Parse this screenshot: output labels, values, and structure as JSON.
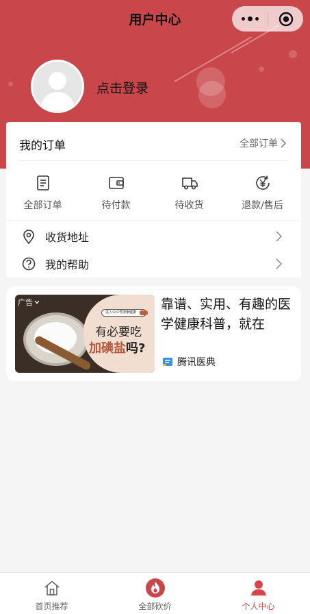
{
  "nav": {
    "title": "用户中心"
  },
  "capsule": {
    "more_icon": "more-dots-icon",
    "close_icon": "target-circle-icon"
  },
  "profile": {
    "login_text": "点击登录",
    "avatar_icon": "default-avatar-icon"
  },
  "orders": {
    "title": "我的订单",
    "all_label": "全部订单",
    "items": [
      {
        "label": "全部订单",
        "icon": "order-list-icon"
      },
      {
        "label": "待付款",
        "icon": "wallet-icon"
      },
      {
        "label": "待收货",
        "icon": "delivery-truck-icon"
      },
      {
        "label": "退款/售后",
        "icon": "refund-yen-icon"
      }
    ]
  },
  "menu": {
    "items": [
      {
        "label": "收货地址",
        "icon": "location-pin-icon"
      },
      {
        "label": "我的帮助",
        "icon": "help-circle-icon"
      }
    ]
  },
  "ad": {
    "badge": "广告",
    "image_caption_small": "进入公众号搜索健康",
    "image_headline_1": "有必要吃",
    "image_headline_2_red": "加碘盐",
    "image_headline_2_dark": "吗?",
    "description": "靠谱、实用、有趣的医学健康科普，就在",
    "source": "腾讯医典"
  },
  "tabbar": {
    "active_color": "#d9464a",
    "items": [
      {
        "label": "首页推荐",
        "icon": "home-icon"
      },
      {
        "label": "全部砍价",
        "icon": "flame-icon"
      },
      {
        "label": "个人中心",
        "icon": "person-icon"
      }
    ]
  },
  "colors": {
    "header": "#c9464a",
    "accent": "#d9464a"
  }
}
